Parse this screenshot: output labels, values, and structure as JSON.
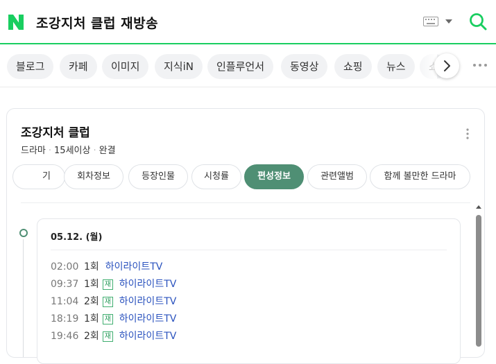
{
  "header": {
    "logo": "N",
    "query": "조강지처 클럽 재방송",
    "icons": [
      "naver-logo-icon",
      "keyboard-icon",
      "dropdown-arrow-icon",
      "search-icon"
    ],
    "accent_color": "#19ce60"
  },
  "tabs": {
    "items": [
      {
        "label": "블로그"
      },
      {
        "label": "카페"
      },
      {
        "label": "이미지"
      },
      {
        "label": "지식iN"
      },
      {
        "label": "인플루언서"
      },
      {
        "label": "동영상"
      },
      {
        "label": "쇼핑"
      },
      {
        "label": "뉴스"
      },
      {
        "label": "쇼"
      }
    ],
    "icons": [
      "chevron-right-icon",
      "more-dots-icon"
    ]
  },
  "program": {
    "title": "조강지처 클럽",
    "genre": "드라마",
    "rating": "15세이상",
    "status": "완결",
    "sub_tabs": [
      {
        "label": "기"
      },
      {
        "label": "회차정보"
      },
      {
        "label": "등장인물"
      },
      {
        "label": "시청률"
      },
      {
        "label": "편성정보",
        "active": true
      },
      {
        "label": "관련앨범"
      },
      {
        "label": "함께 볼만한 드라마"
      }
    ],
    "active_color": "#4f8f74"
  },
  "schedule": {
    "date": "05.12. (월)",
    "rerun_badge": "재",
    "rows": [
      {
        "time": "02:00",
        "episode": "1회",
        "rerun": false,
        "channel": "하이라이트TV"
      },
      {
        "time": "09:37",
        "episode": "1회",
        "rerun": true,
        "channel": "하이라이트TV"
      },
      {
        "time": "11:04",
        "episode": "2회",
        "rerun": true,
        "channel": "하이라이트TV"
      },
      {
        "time": "18:19",
        "episode": "1회",
        "rerun": true,
        "channel": "하이라이트TV"
      },
      {
        "time": "19:46",
        "episode": "2회",
        "rerun": true,
        "channel": "하이라이트TV"
      }
    ]
  }
}
